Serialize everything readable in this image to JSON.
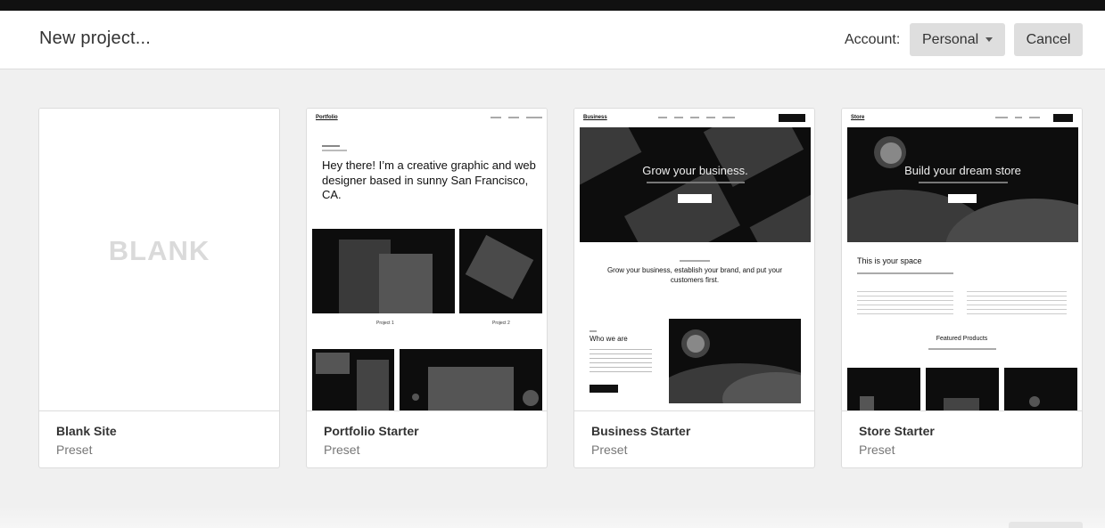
{
  "header": {
    "title": "New project...",
    "account_label": "Account:",
    "account_value": "Personal",
    "cancel_label": "Cancel"
  },
  "cards": [
    {
      "name": "Blank Site",
      "subtitle": "Preset",
      "preview_word": "BLANK"
    },
    {
      "name": "Portfolio Starter",
      "subtitle": "Preset",
      "preview": {
        "logo": "Portfolio",
        "headline": "Hey there! I’m a creative graphic and web designer based in sunny San Francisco, CA.",
        "project1": "Project 1",
        "project2": "Project 2"
      }
    },
    {
      "name": "Business Starter",
      "subtitle": "Preset",
      "preview": {
        "logo": "Business",
        "hero": "Grow your business.",
        "tagline": "Grow your business, establish your brand, and put your customers first.",
        "section": "Who we are"
      }
    },
    {
      "name": "Store Starter",
      "subtitle": "Preset",
      "preview": {
        "logo": "Store",
        "hero": "Build your dream store",
        "section": "This is your space",
        "featured": "Featured Products"
      }
    }
  ],
  "colors": {
    "page_bg": "#f0f0f0",
    "button_bg": "#dedede",
    "dark": "#0d0d0d"
  }
}
